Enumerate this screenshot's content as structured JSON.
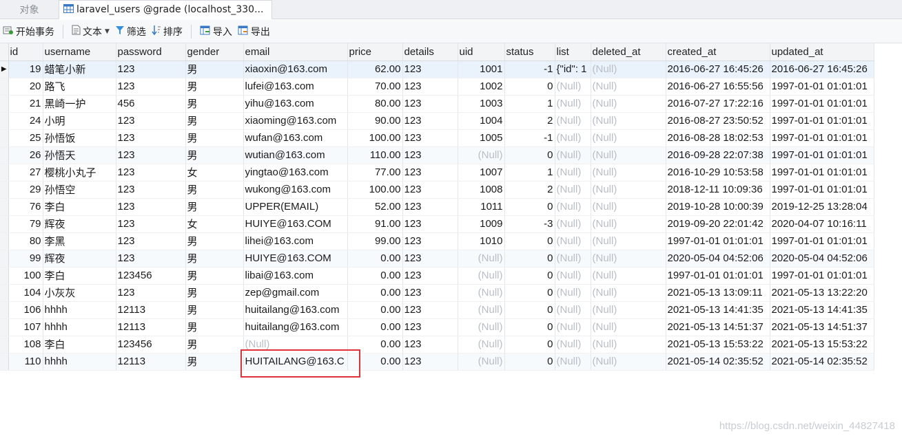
{
  "tabs": {
    "objects": "对象",
    "active": "laravel_users @grade (localhost_330..."
  },
  "toolbar": {
    "begin_transaction": "开始事务",
    "text": "文本",
    "filter": "筛选",
    "sort": "排序",
    "import": "导入",
    "export": "导出"
  },
  "columns": [
    "id",
    "username",
    "password",
    "gender",
    "email",
    "price",
    "details",
    "uid",
    "status",
    "list",
    "deleted_at",
    "created_at",
    "updated_at"
  ],
  "rows": [
    [
      "19",
      "蜡笔小新",
      "123",
      "男",
      "xiaoxin@163.com",
      "62.00",
      "123",
      "1001",
      "-1",
      "{\"id\": 1",
      "(Null)",
      "2016-06-27 16:45:26",
      "2016-06-27 16:45:26"
    ],
    [
      "20",
      "路飞",
      "123",
      "男",
      "lufei@163.com",
      "70.00",
      "123",
      "1002",
      "0",
      "(Null)",
      "(Null)",
      "2016-06-27 16:55:56",
      "1997-01-01 01:01:01"
    ],
    [
      "21",
      "黑崎一护",
      "456",
      "男",
      "yihu@163.com",
      "80.00",
      "123",
      "1003",
      "1",
      "(Null)",
      "(Null)",
      "2016-07-27 17:22:16",
      "1997-01-01 01:01:01"
    ],
    [
      "24",
      "小明",
      "123",
      "男",
      "xiaoming@163.com",
      "90.00",
      "123",
      "1004",
      "2",
      "(Null)",
      "(Null)",
      "2016-08-27 23:50:52",
      "1997-01-01 01:01:01"
    ],
    [
      "25",
      "孙悟饭",
      "123",
      "男",
      "wufan@163.com",
      "100.00",
      "123",
      "1005",
      "-1",
      "(Null)",
      "(Null)",
      "2016-08-28 18:02:53",
      "1997-01-01 01:01:01"
    ],
    [
      "26",
      "孙悟天",
      "123",
      "男",
      "wutian@163.com",
      "110.00",
      "123",
      "(Null)",
      "0",
      "(Null)",
      "(Null)",
      "2016-09-28 22:07:38",
      "1997-01-01 01:01:01"
    ],
    [
      "27",
      "樱桃小丸子",
      "123",
      "女",
      "yingtao@163.com",
      "77.00",
      "123",
      "1007",
      "1",
      "(Null)",
      "(Null)",
      "2016-10-29 10:53:58",
      "1997-01-01 01:01:01"
    ],
    [
      "29",
      "孙悟空",
      "123",
      "男",
      "wukong@163.com",
      "100.00",
      "123",
      "1008",
      "2",
      "(Null)",
      "(Null)",
      "2018-12-11 10:09:36",
      "1997-01-01 01:01:01"
    ],
    [
      "76",
      "李白",
      "123",
      "男",
      "UPPER(EMAIL)",
      "52.00",
      "123",
      "1011",
      "0",
      "(Null)",
      "(Null)",
      "2019-10-28 10:00:39",
      "2019-12-25 13:28:04"
    ],
    [
      "79",
      "辉夜",
      "123",
      "女",
      "HUIYE@163.COM",
      "91.00",
      "123",
      "1009",
      "-3",
      "(Null)",
      "(Null)",
      "2019-09-20 22:01:42",
      "2020-04-07 10:16:11"
    ],
    [
      "80",
      "李黑",
      "123",
      "男",
      "lihei@163.com",
      "99.00",
      "123",
      "1010",
      "0",
      "(Null)",
      "(Null)",
      "1997-01-01 01:01:01",
      "1997-01-01 01:01:01"
    ],
    [
      "99",
      "辉夜",
      "123",
      "男",
      "HUIYE@163.COM",
      "0.00",
      "123",
      "(Null)",
      "0",
      "(Null)",
      "(Null)",
      "2020-05-04 04:52:06",
      "2020-05-04 04:52:06"
    ],
    [
      "100",
      "李白",
      "123456",
      "男",
      "libai@163.com",
      "0.00",
      "123",
      "(Null)",
      "0",
      "(Null)",
      "(Null)",
      "1997-01-01 01:01:01",
      "1997-01-01 01:01:01"
    ],
    [
      "104",
      "小灰灰",
      "123",
      "男",
      "zep@gmail.com",
      "0.00",
      "123",
      "(Null)",
      "0",
      "(Null)",
      "(Null)",
      "2021-05-13 13:09:11",
      "2021-05-13 13:22:20"
    ],
    [
      "106",
      "hhhh",
      "12113",
      "男",
      "huitailang@163.com",
      "0.00",
      "123",
      "(Null)",
      "0",
      "(Null)",
      "(Null)",
      "2021-05-13 14:41:35",
      "2021-05-13 14:41:35"
    ],
    [
      "107",
      "hhhh",
      "12113",
      "男",
      "huitailang@163.com",
      "0.00",
      "123",
      "(Null)",
      "0",
      "(Null)",
      "(Null)",
      "2021-05-13 14:51:37",
      "2021-05-13 14:51:37"
    ],
    [
      "108",
      "李白",
      "123456",
      "男",
      "(Null)",
      "0.00",
      "123",
      "(Null)",
      "0",
      "(Null)",
      "(Null)",
      "2021-05-13 15:53:22",
      "2021-05-13 15:53:22"
    ],
    [
      "110",
      "hhhh",
      "12113",
      "男",
      "HUITAILANG@163.C",
      "0.00",
      "123",
      "(Null)",
      "0",
      "(Null)",
      "(Null)",
      "2021-05-14 02:35:52",
      "2021-05-14 02:35:52"
    ]
  ],
  "current_row_marker": "▶",
  "watermark": "https://blog.csdn.net/weixin_44827418",
  "colors": {
    "null_text": "#b9bec6",
    "highlight_border": "#e0313a",
    "selected_row": "#eaf2fb"
  }
}
